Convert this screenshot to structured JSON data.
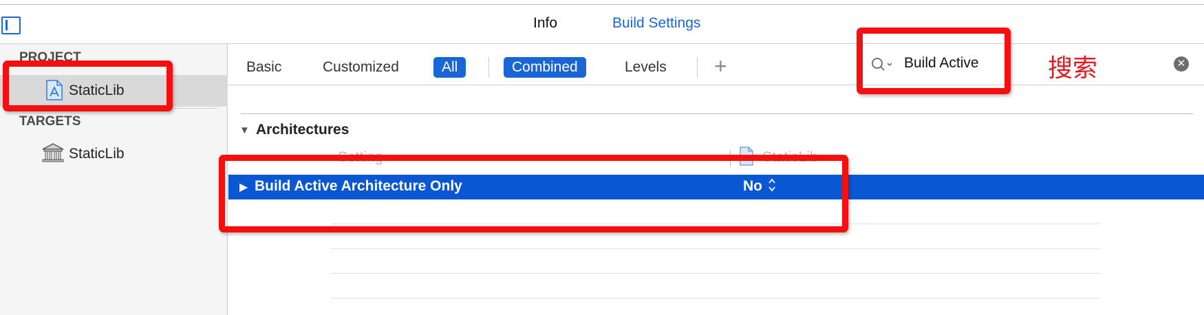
{
  "tabs": [
    {
      "label": "Info",
      "selected": false
    },
    {
      "label": "Build Settings",
      "selected": true
    }
  ],
  "sidebar": {
    "project_header": "PROJECT",
    "project_item": "StaticLib",
    "targets_header": "TARGETS",
    "target_item": "StaticLib"
  },
  "filters": {
    "basic": "Basic",
    "customized": "Customized",
    "all": "All",
    "combined": "Combined",
    "levels": "Levels",
    "add": "+"
  },
  "search": {
    "value": "Build Active"
  },
  "annotation": {
    "search_label": "搜索"
  },
  "section": {
    "title": "Architectures",
    "column_setting": "Setting",
    "column_target": "StaticLib"
  },
  "setting_row": {
    "name": "Build Active Architecture Only",
    "value": "No"
  },
  "icons": [
    "sidebar-toggle-icon",
    "project-file-icon",
    "target-library-icon",
    "search-icon",
    "clear-icon",
    "disclosure-triangle-icon",
    "stepper-icon"
  ],
  "colors": {
    "accent": "#1a66d6",
    "selected_row": "#0a57d3",
    "annotation_red": "#f50f0f"
  }
}
